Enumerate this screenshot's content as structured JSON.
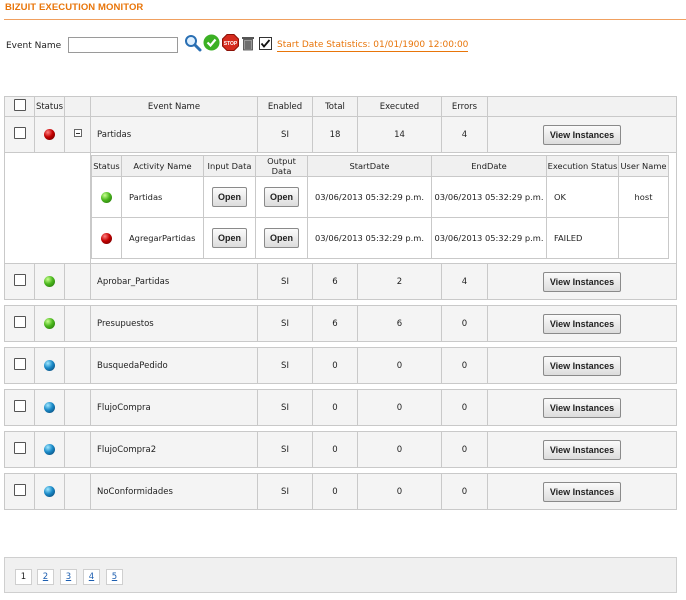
{
  "header": {
    "title": "BIZUIT EXECUTION MONITOR"
  },
  "search": {
    "label": "Event Name",
    "value": "",
    "placeholder": "",
    "stat_link": "Start Date Statistics: 01/01/1900 12:00:00"
  },
  "grid": {
    "columns": [
      "Status",
      "Event Name",
      "Enabled",
      "Total",
      "Executed",
      "Errors"
    ],
    "button_label": "View Instances",
    "rows": [
      {
        "status": "red",
        "name": "Partidas",
        "enabled": "SI",
        "total": "18",
        "executed": "14",
        "errors": "4",
        "expanded": true
      },
      {
        "status": "green",
        "name": "Aprobar_Partidas",
        "enabled": "SI",
        "total": "6",
        "executed": "2",
        "errors": "4"
      },
      {
        "status": "green",
        "name": "Presupuestos",
        "enabled": "SI",
        "total": "6",
        "executed": "6",
        "errors": "0"
      },
      {
        "status": "blue",
        "name": "BusquedaPedido",
        "enabled": "SI",
        "total": "0",
        "executed": "0",
        "errors": "0"
      },
      {
        "status": "blue",
        "name": "FlujoCompra",
        "enabled": "SI",
        "total": "0",
        "executed": "0",
        "errors": "0"
      },
      {
        "status": "blue",
        "name": "FlujoCompra2",
        "enabled": "SI",
        "total": "0",
        "executed": "0",
        "errors": "0"
      },
      {
        "status": "blue",
        "name": "NoConformidades",
        "enabled": "SI",
        "total": "0",
        "executed": "0",
        "errors": "0"
      }
    ]
  },
  "subgrid": {
    "columns": [
      "Status",
      "Activity Name",
      "Input Data",
      "Output Data",
      "StartDate",
      "EndDate",
      "Execution Status",
      "User Name"
    ],
    "open_label": "Open",
    "rows": [
      {
        "status": "green",
        "activity": "Partidas",
        "start": "03/06/2013 05:32:29 p.m.",
        "end": "03/06/2013 05:32:29 p.m.",
        "exec_status": "OK",
        "user": "host"
      },
      {
        "status": "red",
        "activity": "AgregarPartidas",
        "start": "03/06/2013 05:32:29 p.m.",
        "end": "03/06/2013 05:32:29 p.m.",
        "exec_status": "FAILED",
        "user": ""
      }
    ]
  },
  "pager": {
    "pages": [
      "1",
      "2",
      "3",
      "4",
      "5"
    ],
    "current": "1"
  },
  "icons": {
    "search": "magnifier-icon",
    "run": "green-check-icon",
    "stop": "stop-icon",
    "delete": "trash-icon",
    "select_all": "checkbox-icon"
  },
  "colors": {
    "accent": "#e8750a",
    "link": "#1e5fb0"
  }
}
